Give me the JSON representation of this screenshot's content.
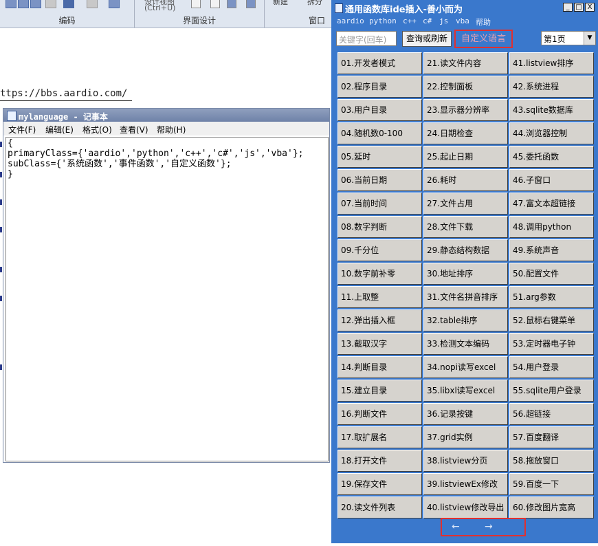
{
  "ide": {
    "groups": [
      {
        "label": "编码"
      },
      {
        "label": "界面设计"
      },
      {
        "label": "窗口"
      }
    ],
    "ribbon_partial_text": {
      "view_caption": "设计视图",
      "view_shortcut": "(Ctrl+U)",
      "new": "新建",
      "split": "拆分"
    }
  },
  "editor": {
    "url": "ttps://bbs.aardio.com/"
  },
  "notepad": {
    "title": "mylanguage - 记事本",
    "menu": [
      "文件(F)",
      "编辑(E)",
      "格式(O)",
      "查看(V)",
      "帮助(H)"
    ],
    "content": "{\nprimaryClass={'aardio','python','c++','c#','js','vba'};\nsubClass={'系统函数','事件函数','自定义函数'};\n}"
  },
  "panel": {
    "title": "通用函数库ide插入-善小而为",
    "window_buttons": {
      "minimize": "_",
      "maximize": "□",
      "close": "X"
    },
    "menu": [
      "aardio",
      "python",
      "c++",
      "c#",
      "js",
      "vba",
      "帮助"
    ],
    "search_placeholder": "关键字(回车)",
    "query_button": "查询或刷新",
    "custom_language_button": "自定义语言",
    "page_select": "第1页",
    "nav": {
      "prev": "←",
      "next": "→"
    },
    "accent_color": "#3a78cc",
    "highlight_color": "#e03030",
    "columns": [
      [
        "01.开发者模式",
        "02.程序目录",
        "03.用户目录",
        "04.随机数0-100",
        "05.延时",
        "06.当前日期",
        "07.当前时间",
        "08.数字判断",
        "09.千分位",
        "10.数字前补零",
        "11.上取整",
        "12.弹出插入框",
        "13.截取汉字",
        "14.判断目录",
        "15.建立目录",
        "16.判断文件",
        "17.取扩展名",
        "18.打开文件",
        "19.保存文件",
        "20.读文件列表"
      ],
      [
        "21.读文件内容",
        "22.控制面板",
        "23.显示器分辨率",
        "24.日期检查",
        "25.起止日期",
        "26.耗时",
        "27.文件占用",
        "28.文件下载",
        "29.静态结构数据",
        "30.地址排序",
        "31.文件名拼音排序",
        "32.table排序",
        "33.检测文本编码",
        "34.nopi读写excel",
        "35.libxl读写excel",
        "36.记录按键",
        "37.grid实例",
        "38.listview分页",
        "39.listviewEx修改",
        "40.listview修改导出"
      ],
      [
        "41.listview排序",
        "42.系统进程",
        "43.sqlite数据库",
        "44.浏览器控制",
        "45.委托函数",
        "46.子窗口",
        "47.富文本超链接",
        "48.调用python",
        "49.系统声音",
        "50.配置文件",
        "51.arg参数",
        "52.鼠标右键菜单",
        "53.定时器电子钟",
        "54.用户登录",
        "55.sqlite用户登录",
        "56.超链接",
        "57.百度翻译",
        "58.拖放窗口",
        "59.百度一下",
        "60.修改图片宽高"
      ]
    ]
  }
}
